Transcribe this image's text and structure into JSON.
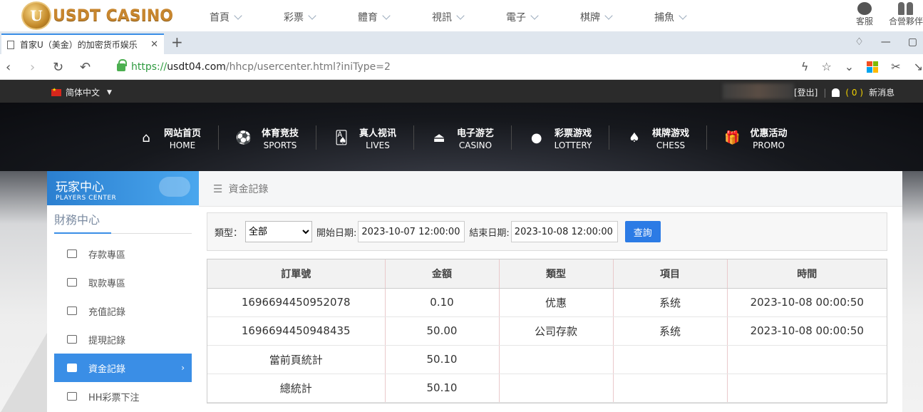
{
  "site": {
    "logo_letter": "U",
    "logo_text": "USDT CASINO",
    "nav": [
      "首頁",
      "彩票",
      "體育",
      "視訊",
      "電子",
      "棋牌",
      "捕魚"
    ],
    "right": [
      {
        "label": "客服",
        "icon": "chat-icon"
      },
      {
        "label": "合營夥伴",
        "icon": "partner-icon"
      }
    ]
  },
  "browser": {
    "tab_title": "首家U（美金）的加密货币娱乐",
    "tab_close": "✕",
    "new_tab": "+",
    "url_scheme": "https://",
    "url_host": "usdt04.com",
    "url_path": "/hhcp/usercenter.html?iniType=2"
  },
  "utilbar": {
    "language": "简体中文",
    "logout": "[登出]",
    "message_count": "( 0 )",
    "message_label": "新消息"
  },
  "main_nav": [
    {
      "cn": "网站首页",
      "en": "HOME",
      "icon": "home-icon"
    },
    {
      "cn": "体育竞技",
      "en": "SPORTS",
      "icon": "soccer-ball-icon"
    },
    {
      "cn": "真人视讯",
      "en": "LIVES",
      "icon": "cards-icon"
    },
    {
      "cn": "电子游艺",
      "en": "CASINO",
      "icon": "joystick-icon"
    },
    {
      "cn": "彩票游戏",
      "en": "LOTTERY",
      "icon": "lottery-balls-icon"
    },
    {
      "cn": "棋牌游戏",
      "en": "CHESS",
      "icon": "spade-icon"
    },
    {
      "cn": "优惠活动",
      "en": "PROMO",
      "icon": "gift-icon"
    }
  ],
  "sidebar": {
    "title_cn": "玩家中心",
    "title_en": "PLAYERS CENTER",
    "section": "財務中心",
    "items": [
      {
        "label": "存款專區",
        "icon": "deposit-icon",
        "active": false
      },
      {
        "label": "取款專區",
        "icon": "withdraw-icon",
        "active": false
      },
      {
        "label": "充值記錄",
        "icon": "money-bag-icon",
        "active": false
      },
      {
        "label": "提現記錄",
        "icon": "tag-icon",
        "active": false
      },
      {
        "label": "資金記錄",
        "icon": "wallet-icon",
        "active": true
      },
      {
        "label": "HH彩票下注",
        "icon": "list-icon",
        "active": false
      }
    ],
    "active_arrow": "›"
  },
  "panel": {
    "title": "資金記錄",
    "filter": {
      "type_label": "類型：",
      "type_selected": "全部",
      "start_label": "開始日期:",
      "start_value": "2023-10-07 12:00:00",
      "end_label": "結束日期:",
      "end_value": "2023-10-08 12:00:00",
      "query_button": "查詢"
    },
    "table": {
      "headers": [
        "訂單號",
        "金額",
        "類型",
        "項目",
        "時間"
      ],
      "rows": [
        [
          "1696694450952078",
          "0.10",
          "优惠",
          "系统",
          "2023-10-08 00:00:50"
        ],
        [
          "1696694450948435",
          "50.00",
          "公司存款",
          "系统",
          "2023-10-08 00:00:50"
        ],
        [
          "當前頁統計",
          "50.10",
          "",
          "",
          ""
        ],
        [
          "總統計",
          "50.10",
          "",
          "",
          ""
        ]
      ]
    }
  }
}
